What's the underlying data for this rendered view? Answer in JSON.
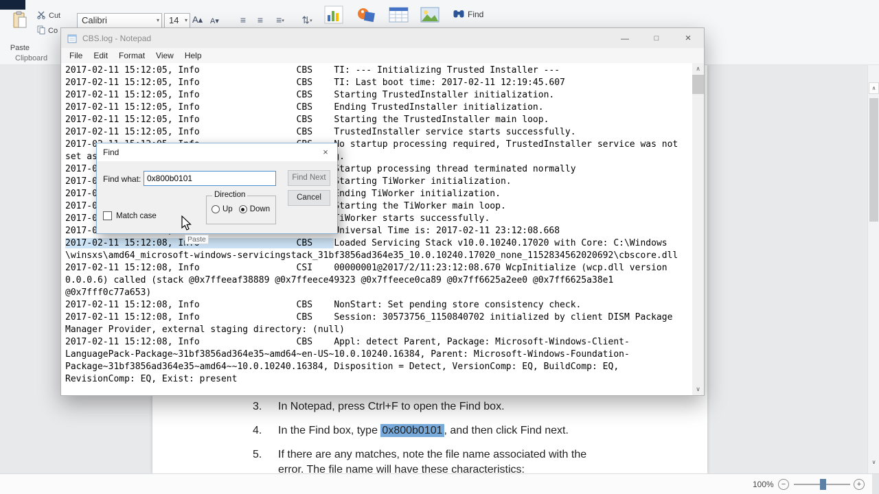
{
  "icons": {
    "dropdown_arrow": "▾",
    "chevron_up": "∧",
    "chevron_down": "∨",
    "minimize": "—",
    "maximize": "□",
    "close": "×",
    "zoom_out": "−",
    "zoom_in": "+",
    "grow_font": "A▴",
    "shrink_font": "A▾",
    "paragraph_lines": "≡",
    "line_spacing": "⇅"
  },
  "ribbon": {
    "paste_label": "Paste",
    "cut_label": "Cut",
    "copy_label": "Co",
    "clipboard_group_label": "Clipboard",
    "font_name": "Calibri",
    "font_size": "14",
    "find_label": "Find"
  },
  "notepad": {
    "window_title": "CBS.log - Notepad",
    "menu_items": [
      "File",
      "Edit",
      "Format",
      "View",
      "Help"
    ],
    "log_a": [
      "2017-02-11 15:12:05, Info                  CBS    TI: --- Initializing Trusted Installer ---",
      "2017-02-11 15:12:05, Info                  CBS    TI: Last boot time: 2017-02-11 12:19:45.607",
      "2017-02-11 15:12:05, Info                  CBS    Starting TrustedInstaller initialization.",
      "2017-02-11 15:12:05, Info                  CBS    Ending TrustedInstaller initialization.",
      "2017-02-11 15:12:05, Info                  CBS    Starting the TrustedInstaller main loop.",
      "2017-02-11 15:12:05, Info                  CBS    TrustedInstaller service starts successfully.",
      "2017-02-11 15:12:05, Info                  CBS    No startup processing required, TrustedInstaller service was not",
      "set as autostart, or else a reboot is still pending.",
      "2017-02-11 15:12:05, Info                  CBS    Startup processing thread terminated normally",
      "2017-02-11 15:12:05, Info                  CBS    Starting TiWorker initialization.",
      "2017-02-11 15:12:05, Info                  CBS    Ending TiWorker initialization.",
      "2017-02-11 15:12:05, Info                  CBS    Starting the TiWorker main loop.",
      "2017-02-11 15:12:05, Info                  CBS    TiWorker starts successfully.",
      "2017-02-11 15:12:08, Info                  CBS    Universal Time is: 2017-02-11 23:12:08.668"
    ],
    "selected_line": {
      "prefix": "2017-02-11 15:12:08, Info                  CBS    ",
      "rest": "Loaded Servicing Stack v10.0.10240.17020 with Core: C:\\Windows"
    },
    "log_b": [
      "\\winsxs\\amd64_microsoft-windows-servicingstack_31bf3856ad364e35_10.0.10240.17020_none_1152834562020692\\cbscore.dll",
      "2017-02-11 15:12:08, Info                  CSI    00000001@2017/2/11:23:12:08.670 WcpInitialize (wcp.dll version",
      "0.0.0.6) called (stack @0x7ffeeaf38889 @0x7ffeece49323 @0x7ffeece0ca89 @0x7ff6625a2ee0 @0x7ff6625a38e1",
      "@0x7fff0c77a653)",
      "2017-02-11 15:12:08, Info                  CBS    NonStart: Set pending store consistency check.",
      "2017-02-11 15:12:08, Info                  CBS    Session: 30573756_1150840702 initialized by client DISM Package",
      "Manager Provider, external staging directory: (null)",
      "2017-02-11 15:12:08, Info                  CBS    Appl: detect Parent, Package: Microsoft-Windows-Client-",
      "LanguagePack-Package~31bf3856ad364e35~amd64~en-US~10.0.10240.16384, Parent: Microsoft-Windows-Foundation-",
      "Package~31bf3856ad364e35~amd64~~10.0.10240.16384, Disposition = Detect, VersionComp: EQ, BuildComp: EQ,",
      "RevisionComp: EQ, Exist: present"
    ],
    "tooltip_label": "Paste"
  },
  "find_dialog": {
    "title": "Find",
    "find_what_label": "Find what:",
    "find_what_value": "0x800b0101",
    "find_next_label": "Find Next",
    "cancel_label": "Cancel",
    "direction_label": "Direction",
    "up_label": "Up",
    "down_label": "Down",
    "selected_direction": "Down",
    "match_case_label": "Match case",
    "match_case_checked": false
  },
  "document": {
    "item3_number": "3.",
    "item3_text": "In Notepad, press Ctrl+F to open the Find box.",
    "item4_number": "4.",
    "item4_text_before": "In the Find box, type ",
    "item4_highlight": "0x800b0101",
    "item4_text_after": ", and then click Find next.",
    "item5_number": "5.",
    "item5_line1": "If there are any matches, note the file name associated with the",
    "item5_line2": "error. The file name will have these characteristics:"
  },
  "status_bar": {
    "zoom_level": "100%"
  }
}
